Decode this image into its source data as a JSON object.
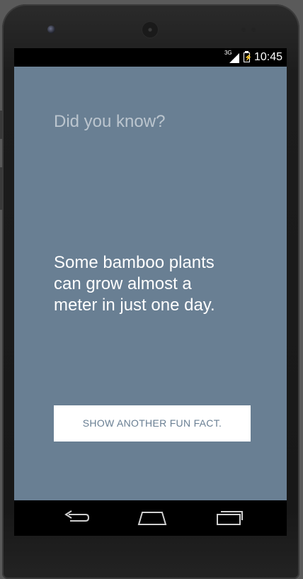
{
  "status_bar": {
    "network": "3G",
    "time": "10:45"
  },
  "content": {
    "title": "Did you know?",
    "fact": "Some bamboo plants can grow almost a meter in just one day.",
    "button_label": "SHOW ANOTHER FUN FACT."
  },
  "navigation": {
    "icons": [
      "back-icon",
      "home-icon",
      "recent-apps-icon"
    ]
  },
  "colors": {
    "background": "#697f93",
    "button_text": "#697f93",
    "button_bg": "#ffffff"
  }
}
